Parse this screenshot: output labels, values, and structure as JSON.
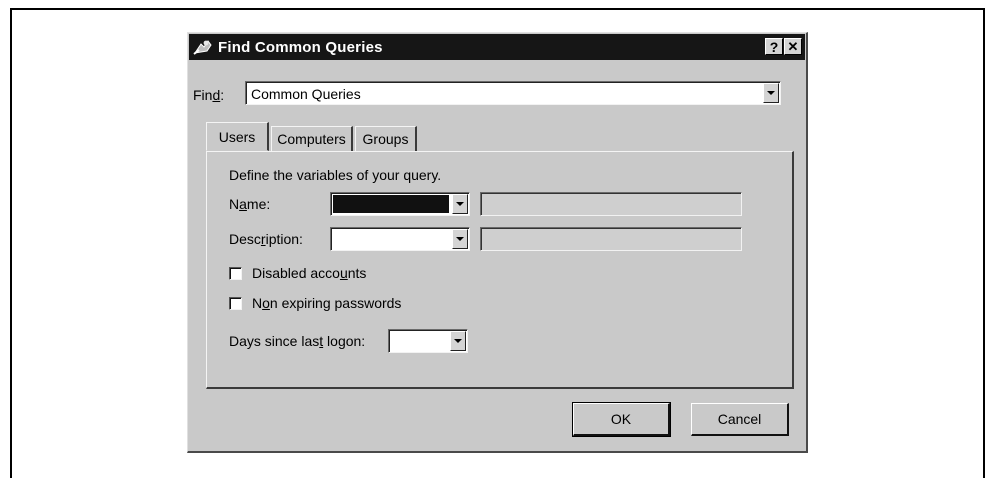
{
  "dialog": {
    "title": "Find Common Queries",
    "help_glyph": "?",
    "close_glyph": "✕",
    "icon": "find-people-icon"
  },
  "find": {
    "label_pre": "Fin",
    "label_key": "d",
    "label_post": ":",
    "value": "Common Queries"
  },
  "tabs": [
    {
      "label": "Users",
      "active": true
    },
    {
      "label": "Computers",
      "active": false
    },
    {
      "label": "Groups",
      "active": false
    }
  ],
  "users_tab": {
    "instruction": "Define the variables of your query.",
    "name_label_pre": "N",
    "name_label_key": "a",
    "name_label_post": "me:",
    "name_value": "",
    "description_label_pre": "Desc",
    "description_label_key": "r",
    "description_label_post": "iption:",
    "description_value": "",
    "disabled_pre": "Disabled acco",
    "disabled_key": "u",
    "disabled_post": "nts",
    "disabled_checked": false,
    "nonexpiring_pre": "N",
    "nonexpiring_key": "o",
    "nonexpiring_post": "n expiring passwords",
    "nonexpiring_checked": false,
    "days_pre": "Days since las",
    "days_key": "t",
    "days_post": " logon:",
    "days_value": ""
  },
  "buttons": {
    "ok": "OK",
    "cancel": "Cancel"
  },
  "colors": {
    "dialog_bg": "#c9c9c9",
    "titlebar_bg": "#161616",
    "titlebar_text": "#ffffff"
  }
}
